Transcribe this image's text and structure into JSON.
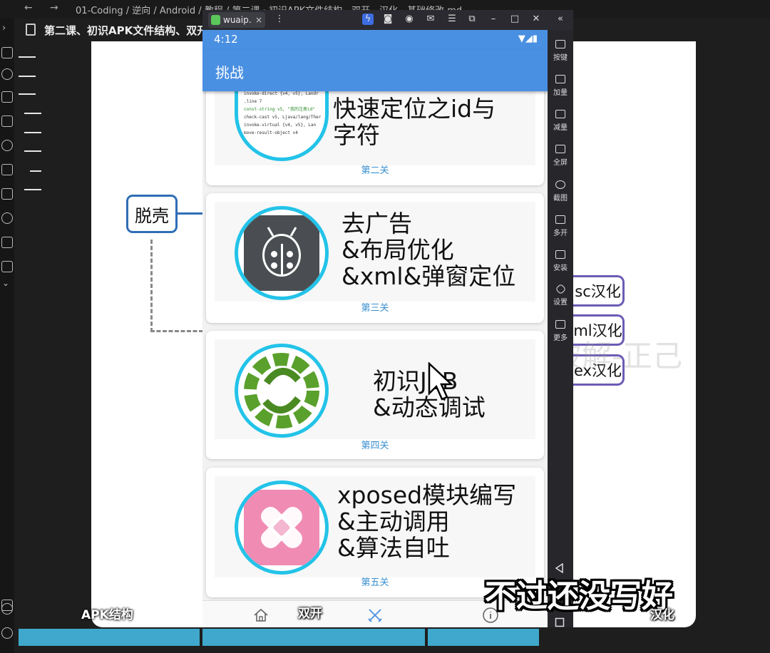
{
  "background_app": {
    "breadcrumb": "01-Coding / 逆向 / Android / 教程 / 第二课 · 初识APK文件结构、双开、汉化、基础修改.md",
    "doc_title": "第二课、初识APK文件结构、双开、汉化、基础修改",
    "mindmap": {
      "root_node": "脱壳",
      "side_nodes": [
        "sc汉化",
        "ml汉化",
        "ex汉化"
      ]
    },
    "watermark": "吾爱破解-正己",
    "bottom_label": "APK结构"
  },
  "emulator": {
    "tab_title": "wuaip…",
    "tab_close": "×",
    "sidebar": [
      {
        "label": "按键",
        "icon": "keyboard-icon"
      },
      {
        "label": "加量",
        "icon": "volume-up-icon"
      },
      {
        "label": "减量",
        "icon": "volume-down-icon"
      },
      {
        "label": "全屏",
        "icon": "fullscreen-icon"
      },
      {
        "label": "截图",
        "icon": "scissors-icon"
      },
      {
        "label": "多开",
        "icon": "multi-instance-icon"
      },
      {
        "label": "安装",
        "icon": "apk-install-icon"
      },
      {
        "label": "设置",
        "icon": "settings-icon"
      },
      {
        "label": "更多",
        "icon": "more-icon"
      }
    ]
  },
  "phone": {
    "status_time": "4:12",
    "appbar_title": "挑战",
    "cards": [
      {
        "title_lines": [
          "快速定位之id与",
          "字符"
        ],
        "level": "第二关",
        "circle_color": "#23c3e8"
      },
      {
        "title_lines": [
          "去广告",
          "&布局优化",
          "&xml&弹窗定位"
        ],
        "level": "第三关",
        "icon": "ladybug-icon"
      },
      {
        "title_lines": [
          "初识JEB",
          "&动态调试"
        ],
        "level": "第四关",
        "icon": "gear-swirl-icon"
      },
      {
        "title_lines": [
          "xposed模块编写",
          "&主动调用",
          "&算法自吐"
        ],
        "level": "第五关",
        "icon": "bandage-icon"
      }
    ],
    "code_lines": [
      "invoke-direct {v4, v5}, Landr",
      ".line 7",
      "const-string v5, \"我的注册id\"",
      "check-cast v5, Ljava/lang/Ther",
      "invoke-virtual {v4, v5}, Lan",
      "move-result-object v4"
    ]
  },
  "captions": {
    "main": "不过还没写好",
    "shuangkai": "双开",
    "hanhua": "汉化"
  },
  "colors": {
    "appbar": "#4a90e2",
    "circle_border": "#23c3e8",
    "level_text": "#3a8fd0",
    "mindmap_blue": "#2f6eb5",
    "mindmap_purple": "#6d5bb5"
  }
}
